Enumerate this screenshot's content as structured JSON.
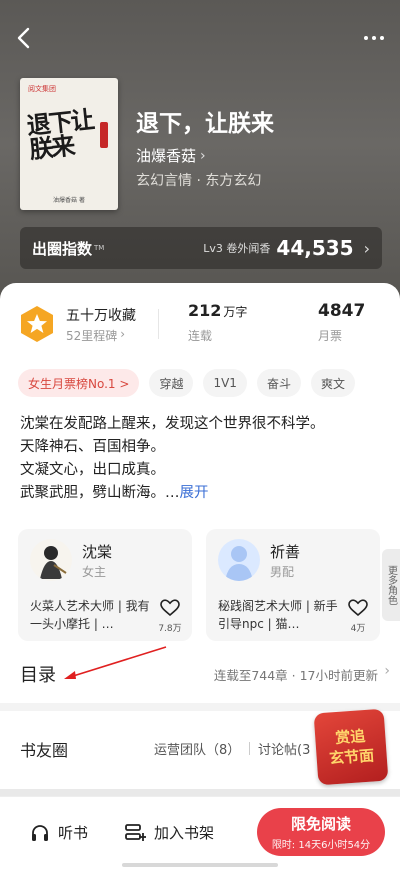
{
  "book": {
    "title": "退下，让朕来",
    "author": "油爆香菇",
    "genre": "玄幻言情 · 东方玄幻",
    "cover_title": "退下让朕来",
    "cover_publisher": "阅文集团",
    "cover_author": "油爆香菇 著"
  },
  "index": {
    "label": "出圈指数",
    "tm": "TM",
    "rank_text": "Lv3 卷外闻香",
    "score": "44,535"
  },
  "stats": {
    "collect_main": "五十万收藏",
    "collect_sub": "52里程碑",
    "words_value": "212",
    "words_unit": "万字",
    "words_sub": "连载",
    "tickets_value": "4847",
    "tickets_sub": "月票"
  },
  "tags": [
    "女生月票榜No.1 >",
    "穿越",
    "1V1",
    "奋斗",
    "爽文"
  ],
  "synopsis": {
    "lines": [
      "沈棠在发配路上醒来，发现这个世界很不科学。",
      "天降神石、百国相争。",
      "文凝文心，出口成真。"
    ],
    "last_line": "武聚武胆，劈山断海。…",
    "expand": "展开"
  },
  "characters": [
    {
      "name": "沈棠",
      "role": "女主",
      "desc": "火菜人艺术大师 | 我有一头小摩托 | …",
      "likes": "7.8万"
    },
    {
      "name": "祈善",
      "role": "男配",
      "desc": "秘践阁艺术大师 | 新手引导npc | 猫…",
      "likes": "4万"
    }
  ],
  "more_roles": "更多角色",
  "toc": {
    "label": "目录",
    "info": "连载至744章 · 17小时前更新"
  },
  "friends": {
    "title": "书友圈",
    "tab1": "运营团队（8）",
    "tab2": "讨论帖(3",
    "promo_line1": "赏追",
    "promo_line2": "玄节面"
  },
  "bottom": {
    "listen": "听书",
    "add_shelf": "加入书架",
    "read_main": "限免阅读",
    "read_sub": "限时: 14天6小时54分"
  },
  "colors": {
    "accent_red": "#e9414a",
    "link_blue": "#3b6fd6",
    "hero_bg": "#5b5956"
  }
}
